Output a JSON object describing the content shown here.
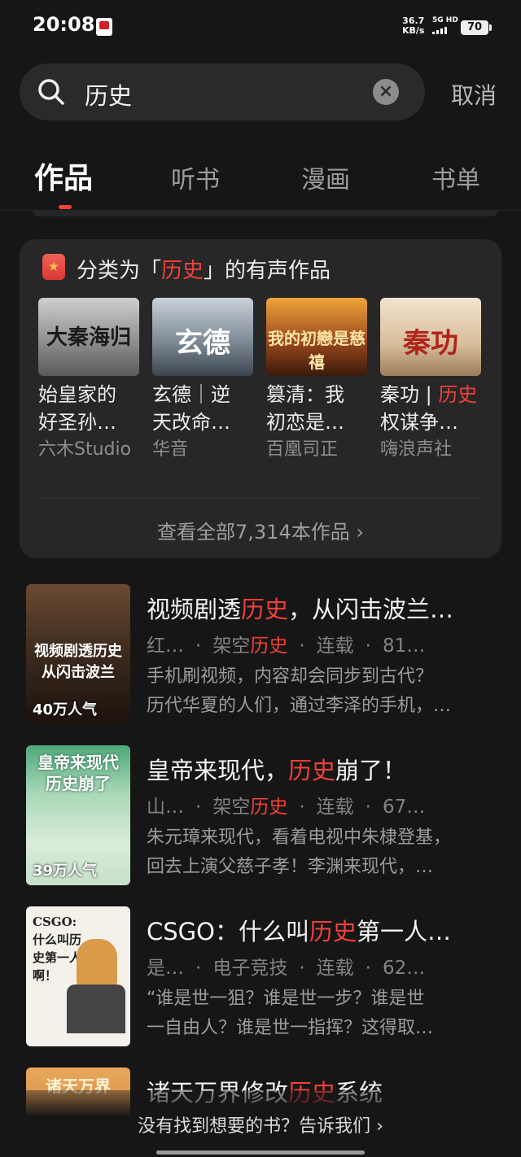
{
  "status_bar": {
    "time": "20:08",
    "net_speed": "36.7",
    "net_unit": "KB/s",
    "signal": "5G HD",
    "battery": "70"
  },
  "search": {
    "query": "历史",
    "cancel_label": "取消"
  },
  "tabs": [
    {
      "label": "作品",
      "active": true
    },
    {
      "label": "听书",
      "active": false
    },
    {
      "label": "漫画",
      "active": false
    },
    {
      "label": "书单",
      "active": false
    }
  ],
  "audio_section": {
    "heading_prefix": "分类为「",
    "heading_keyword": "历史",
    "heading_suffix": "」的有声作品",
    "books": [
      {
        "cover_text": "大秦海归",
        "title_line1": "始皇家的",
        "title_line2": "好圣孙…",
        "author": "六木Studio"
      },
      {
        "cover_text": "玄德",
        "title_line1": "玄德｜逆",
        "title_line2": "天改命…",
        "author": "华音"
      },
      {
        "cover_text": "我的初戀是慈禧",
        "title_line1": "篡清：我",
        "title_line2": "初恋是…",
        "author": "百凰司正"
      },
      {
        "cover_text": "秦功",
        "title_line1": "秦功 | ",
        "title_line1_red": "历史",
        "title_line2": "权谋争…",
        "author": "嗨浪声社"
      }
    ],
    "view_all": "查看全部7,314本作品"
  },
  "results": [
    {
      "cover_text": "视频剧透历史 从闪击波兰",
      "popularity": "40万人气",
      "title_before": "视频剧透",
      "title_keyword": "历史",
      "title_after": "，从闪击波兰…",
      "author": "红…",
      "category_before": "架空",
      "category_keyword": "历史",
      "status": "连载",
      "count": "81…",
      "desc_line1": "手机刷视频，内容却会同步到古代？",
      "desc_line2": "历代华夏的人们，通过李泽的手机，…"
    },
    {
      "cover_text": "皇帝来现代 历史崩了",
      "popularity": "39万人气",
      "title_before": "皇帝来现代，",
      "title_keyword": "历史",
      "title_after": "崩了！",
      "author": "山…",
      "category_before": "架空",
      "category_keyword": "历史",
      "status": "连载",
      "count": "67…",
      "desc_line1": "朱元璋来现代，看着电视中朱棣登基，",
      "desc_line2": "回去上演父慈子孝！李渊来现代，…"
    },
    {
      "cover_text": "CSGO: 什么叫历史第一人啊！",
      "popularity": "",
      "title_before": "CSGO：什么叫",
      "title_keyword": "历史",
      "title_after": "第一人…",
      "author": "是…",
      "category_before": "电子竞技",
      "category_keyword": "",
      "status": "连载",
      "count": "62…",
      "desc_line1": "“谁是世一狙？谁是世一步？谁是世",
      "desc_line2": "一自由人？谁是世一指挥？这得取…"
    },
    {
      "cover_text": "诸天万界",
      "popularity": "",
      "title_before": "诸天万界修改",
      "title_keyword": "历史",
      "title_after": "系统",
      "author": "",
      "category_before": "",
      "category_keyword": "",
      "status": "",
      "count": "",
      "desc_line1": "",
      "desc_line2": ""
    }
  ],
  "footer": {
    "text": "没有找到想要的书？告诉我们"
  },
  "colors": {
    "accent": "#f0413a",
    "background": "#161616",
    "card": "#272727"
  }
}
